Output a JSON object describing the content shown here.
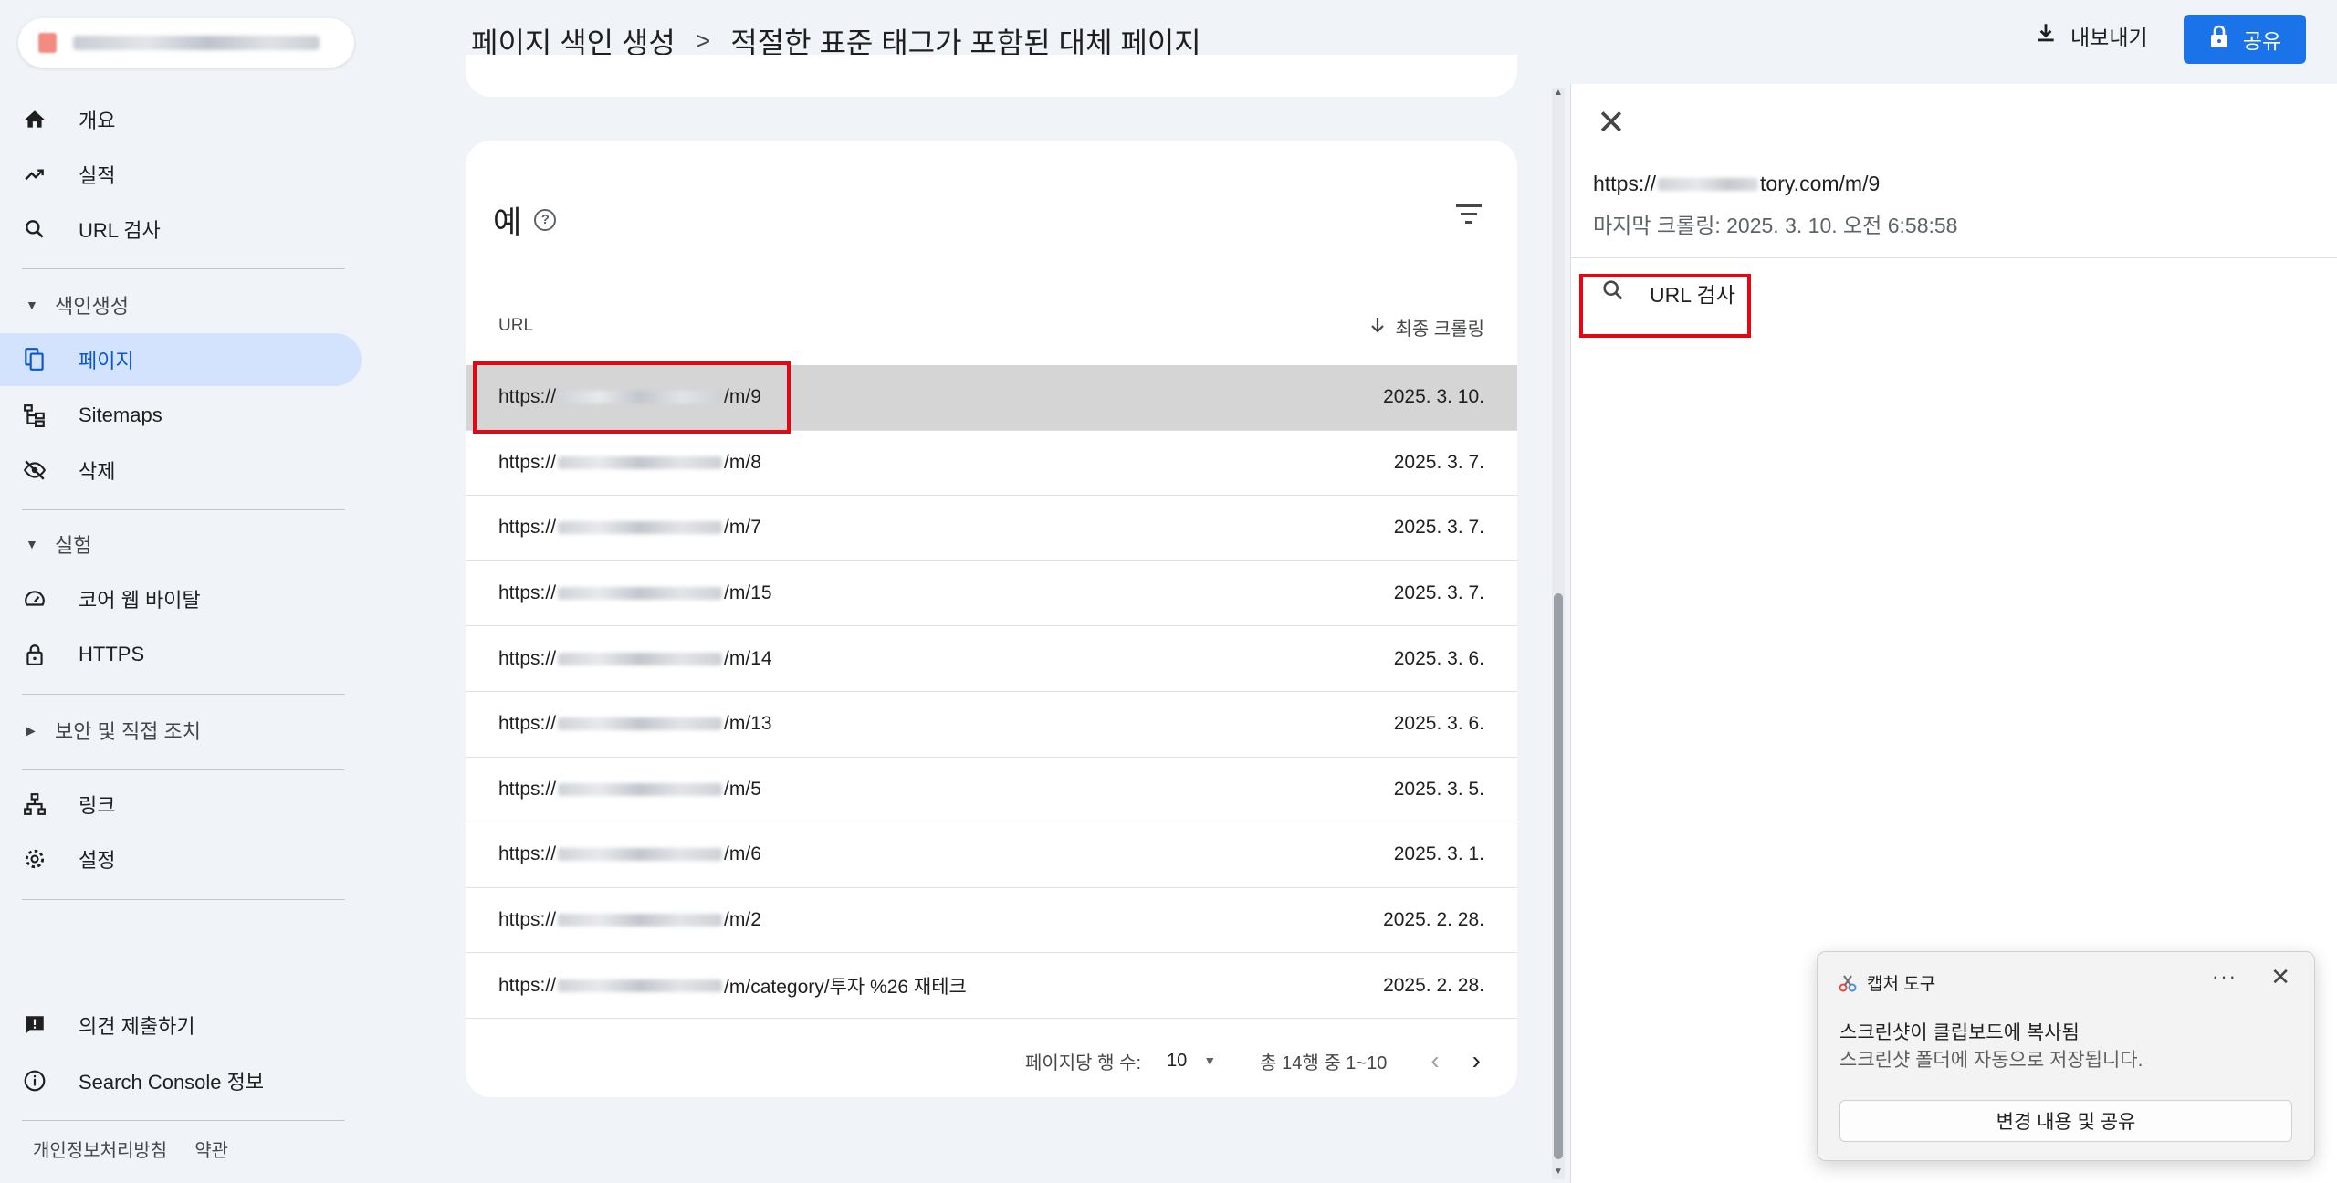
{
  "sidebar": {
    "items": [
      {
        "label": "개요",
        "icon": "home-icon"
      },
      {
        "label": "실적",
        "icon": "trending-up-icon"
      },
      {
        "label": "URL 검사",
        "icon": "search-icon"
      }
    ],
    "section_indexing": "색인생성",
    "indexing_items": [
      {
        "label": "페이지",
        "icon": "pages-icon"
      },
      {
        "label": "Sitemaps",
        "icon": "sitemap-icon"
      },
      {
        "label": "삭제",
        "icon": "visibility-off-icon"
      }
    ],
    "section_experience": "실험",
    "experience_items": [
      {
        "label": "코어 웹 바이탈",
        "icon": "speed-icon"
      },
      {
        "label": "HTTPS",
        "icon": "lock-icon"
      }
    ],
    "section_security": "보안 및 직접 조치",
    "other_items": [
      {
        "label": "링크",
        "icon": "links-icon"
      },
      {
        "label": "설정",
        "icon": "gear-icon"
      }
    ],
    "bottom_items": [
      {
        "label": "의견 제출하기",
        "icon": "feedback-icon"
      },
      {
        "label": "Search Console 정보",
        "icon": "info-icon"
      }
    ],
    "footer": {
      "privacy": "개인정보처리방침",
      "terms": "약관"
    }
  },
  "header": {
    "breadcrumb_parent": "페이지 색인 생성",
    "breadcrumb_separator": ">",
    "breadcrumb_current": "적절한 표준 태그가 포함된 대체 페이지",
    "export_label": "내보내기",
    "share_label": "공유"
  },
  "examples": {
    "title": "예",
    "help": "?",
    "col_url": "URL",
    "col_crawl": "최종 크롤링",
    "rows": [
      {
        "prefix": "https://",
        "suffix": "/m/9",
        "date": "2025. 3. 10."
      },
      {
        "prefix": "https://",
        "suffix": "/m/8",
        "date": "2025. 3. 7."
      },
      {
        "prefix": "https://",
        "suffix": "/m/7",
        "date": "2025. 3. 7."
      },
      {
        "prefix": "https://",
        "suffix": "/m/15",
        "date": "2025. 3. 7."
      },
      {
        "prefix": "https://",
        "suffix": "/m/14",
        "date": "2025. 3. 6."
      },
      {
        "prefix": "https://",
        "suffix": "/m/13",
        "date": "2025. 3. 6."
      },
      {
        "prefix": "https://",
        "suffix": "/m/5",
        "date": "2025. 3. 5."
      },
      {
        "prefix": "https://",
        "suffix": "/m/6",
        "date": "2025. 3. 1."
      },
      {
        "prefix": "https://",
        "suffix": "/m/2",
        "date": "2025. 2. 28."
      },
      {
        "prefix": "https://",
        "suffix": "/m/category/투자 %26 재테크",
        "date": "2025. 2. 28."
      }
    ],
    "selected_row": 0,
    "pagination": {
      "rows_per_page_label": "페이지당 행 수:",
      "rows_per_page": "10",
      "range": "총 14행 중 1~10"
    }
  },
  "detail_panel": {
    "url_prefix": "https://",
    "url_suffix": "tory.com/m/9",
    "last_crawl": "마지막 크롤링: 2025. 3. 10. 오전 6:58:58",
    "inspect_label": "URL 검사"
  },
  "toast": {
    "app_name": "캡처 도구",
    "more": "···",
    "message": "스크린샷이 클립보드에 복사됨",
    "sub_message": "스크린샷 폴더에 자동으로 저장됩니다.",
    "action_label": "변경 내용 및 공유"
  },
  "colors": {
    "accent": "#1a73e8",
    "active_nav": "#d3e3fd",
    "highlight": "#e30613"
  }
}
